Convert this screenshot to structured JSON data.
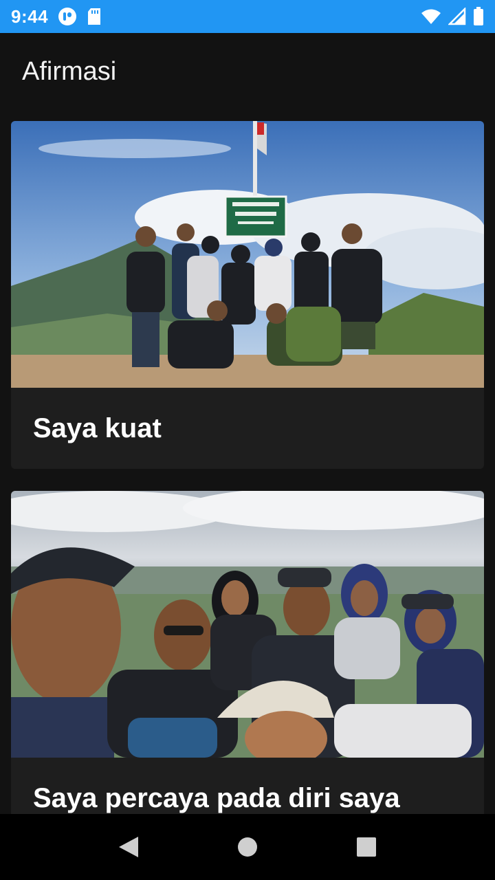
{
  "status_bar": {
    "time": "9:44",
    "background": "#2196F3",
    "icons": [
      "app-notification-icon",
      "sd-card-icon",
      "wifi-icon",
      "signal-icon",
      "battery-icon"
    ]
  },
  "app_bar": {
    "title": "Afirmasi"
  },
  "cards": [
    {
      "image": "group-photo-summit-sign",
      "text": "Saya kuat"
    },
    {
      "image": "group-selfie-mountain-view",
      "text": "Saya percaya pada diri saya"
    }
  ],
  "nav_bar": {
    "icons": [
      "back-icon",
      "home-icon",
      "recents-icon"
    ]
  }
}
